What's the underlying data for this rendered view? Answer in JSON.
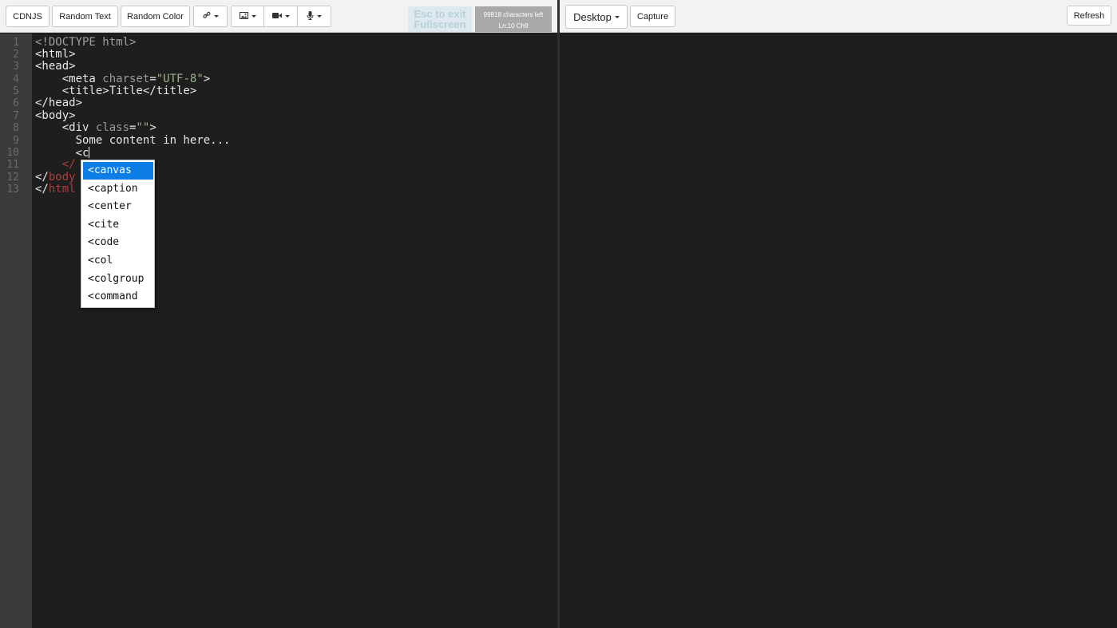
{
  "left_toolbar": {
    "cdnjs": "CDNJS",
    "random_text": "Random Text",
    "random_color": "Random Color",
    "link_icon": "link-icon",
    "image_icon": "image-icon",
    "video_icon": "video-icon",
    "mic_icon": "microphone-icon",
    "esc_line1": "Esc to exit",
    "esc_line2": "Fullscreen",
    "chars_left": "99818 characters left",
    "cursor_pos": "Ln:10 Ch9"
  },
  "right_toolbar": {
    "device": "Desktop",
    "capture": "Capture",
    "refresh": "Refresh"
  },
  "editor": {
    "line_numbers": [
      "1",
      "2",
      "3",
      "4",
      "5",
      "6",
      "7",
      "8",
      "9",
      "10",
      "11",
      "12",
      "13"
    ],
    "lines": {
      "l1": "<!DOCTYPE html>",
      "l2": "<html>",
      "l3": "<head>",
      "l4_a": "    <meta ",
      "l4_b": "charset",
      "l4_c": "=",
      "l4_d": "\"UTF-8\"",
      "l4_e": ">",
      "l5": "    <title>Title</title>",
      "l6": "</head>",
      "l7": "<body>",
      "l8_a": "    <div ",
      "l8_b": "class",
      "l8_c": "=",
      "l8_d": "\"\"",
      "l8_e": ">",
      "l9": "      Some content in here...",
      "l10": "      <c",
      "l11": "    </",
      "l12_a": "</",
      "l12_b": "body",
      "l13_a": "</",
      "l13_b": "html"
    }
  },
  "autocomplete": {
    "items": [
      "<canvas",
      "<caption",
      "<center",
      "<cite",
      "<code",
      "<col",
      "<colgroup",
      "<command"
    ],
    "selected_index": 0
  },
  "colors": {
    "accent": "#0d7ee6",
    "editor_bg": "#1e1e1e",
    "gutter_bg": "#3a3a3a"
  }
}
